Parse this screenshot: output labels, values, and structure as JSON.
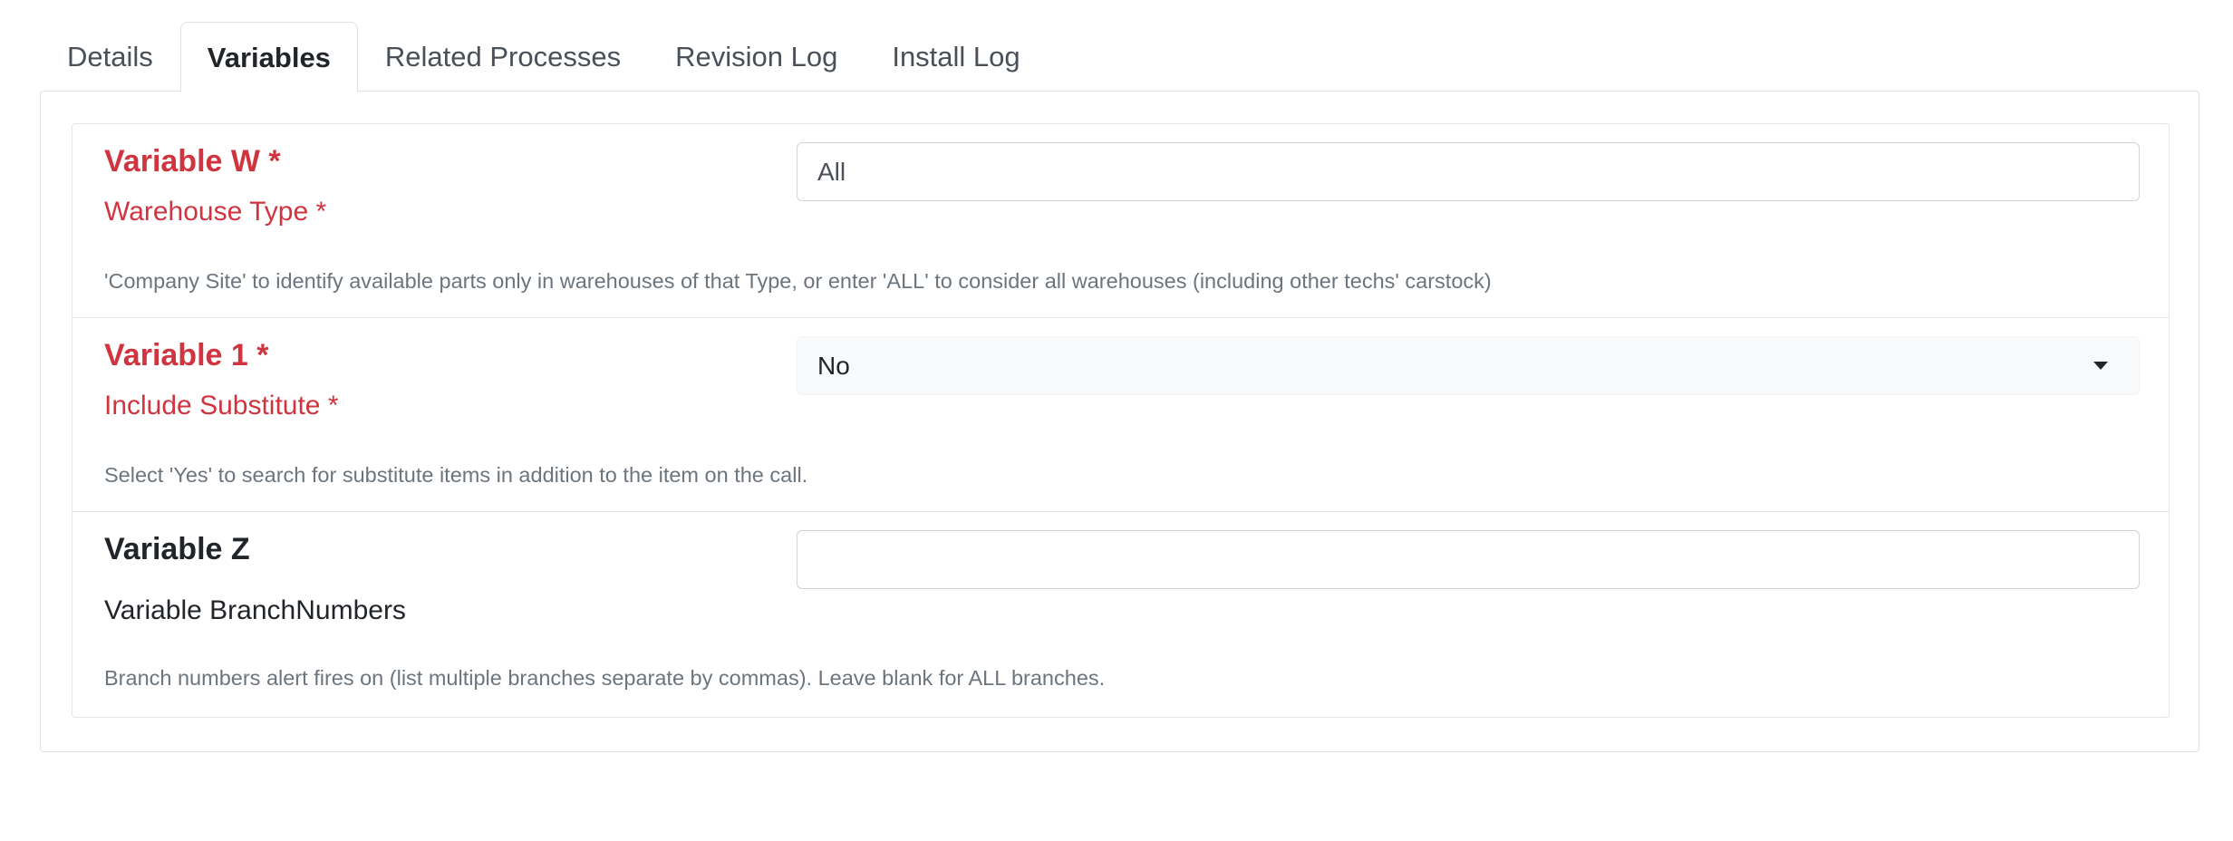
{
  "tabs": [
    {
      "label": "Details",
      "active": false
    },
    {
      "label": "Variables",
      "active": true
    },
    {
      "label": "Related Processes",
      "active": false
    },
    {
      "label": "Revision Log",
      "active": false
    },
    {
      "label": "Install Log",
      "active": false
    }
  ],
  "variables": [
    {
      "title": "Variable W *",
      "subtitle": "Warehouse Type *",
      "help": "'Company Site' to identify available parts only in warehouses of that Type, or enter 'ALL' to consider all warehouses (including other techs' carstock)",
      "value": "All",
      "control": "text",
      "required": true
    },
    {
      "title": "Variable 1 *",
      "subtitle": "Include Substitute *",
      "help": "Select 'Yes' to search for substitute items in addition to the item on the call.",
      "value": "No",
      "control": "select",
      "required": true
    },
    {
      "title": "Variable Z",
      "subtitle": "Variable BranchNumbers",
      "help": "Branch numbers alert fires on (list multiple branches separate by commas). Leave blank for ALL branches.",
      "value": "",
      "control": "text",
      "required": false
    }
  ],
  "colors": {
    "required_label": "#d0343f",
    "help_text": "#6c757d",
    "border": "#dee2e6"
  }
}
